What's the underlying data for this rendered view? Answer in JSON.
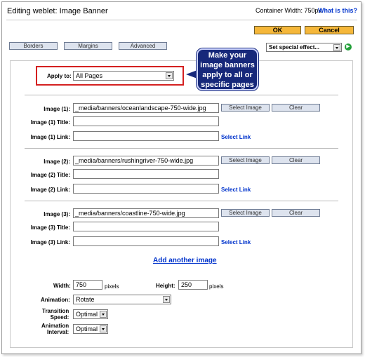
{
  "header": {
    "title": "Editing weblet: Image Banner",
    "container_width": "Container Width: 750px",
    "help_link": "What is this?"
  },
  "actions": {
    "ok": "OK",
    "cancel": "Cancel"
  },
  "tabs": [
    "Borders",
    "Margins",
    "Advanced"
  ],
  "effects": {
    "value": "Set special effect..."
  },
  "apply_to": {
    "label": "Apply to:",
    "value": "All Pages"
  },
  "callout": {
    "text": "Make your image banners apply to all or specific pages"
  },
  "images": [
    {
      "label": "Image (1):",
      "path": "_media/banners/oceanlandscape-750-wide.jpg",
      "title_label": "Image (1) Title:",
      "link_label": "Image (1) Link:"
    },
    {
      "label": "Image (2):",
      "path": "_media/banners/rushingriver-750-wide.jpg",
      "title_label": "Image (2) Title:",
      "link_label": "Image (2) Link:"
    },
    {
      "label": "Image (3):",
      "path": "_media/banners/coastline-750-wide.jpg",
      "title_label": "Image (3) Title:",
      "link_label": "Image (3) Link:"
    }
  ],
  "buttons": {
    "select_image": "Select Image",
    "clear": "Clear",
    "select_link": "Select Link"
  },
  "add_image": "Add another image",
  "settings": {
    "width_label": "Width:",
    "width_value": "750",
    "width_unit": "pixels",
    "height_label": "Height:",
    "height_value": "250",
    "height_unit": "pixels",
    "animation_label": "Animation:",
    "animation_value": "Rotate",
    "speed_label_1": "Transition",
    "speed_label_2": "Speed:",
    "speed_value": "Optimal",
    "interval_label_1": "Animation",
    "interval_label_2": "Interval:",
    "interval_value": "Optimal"
  },
  "colors": {
    "ok_button": "#f5b73a",
    "link": "#0033cc",
    "highlight": "#d42020",
    "callout": "#16287a"
  }
}
